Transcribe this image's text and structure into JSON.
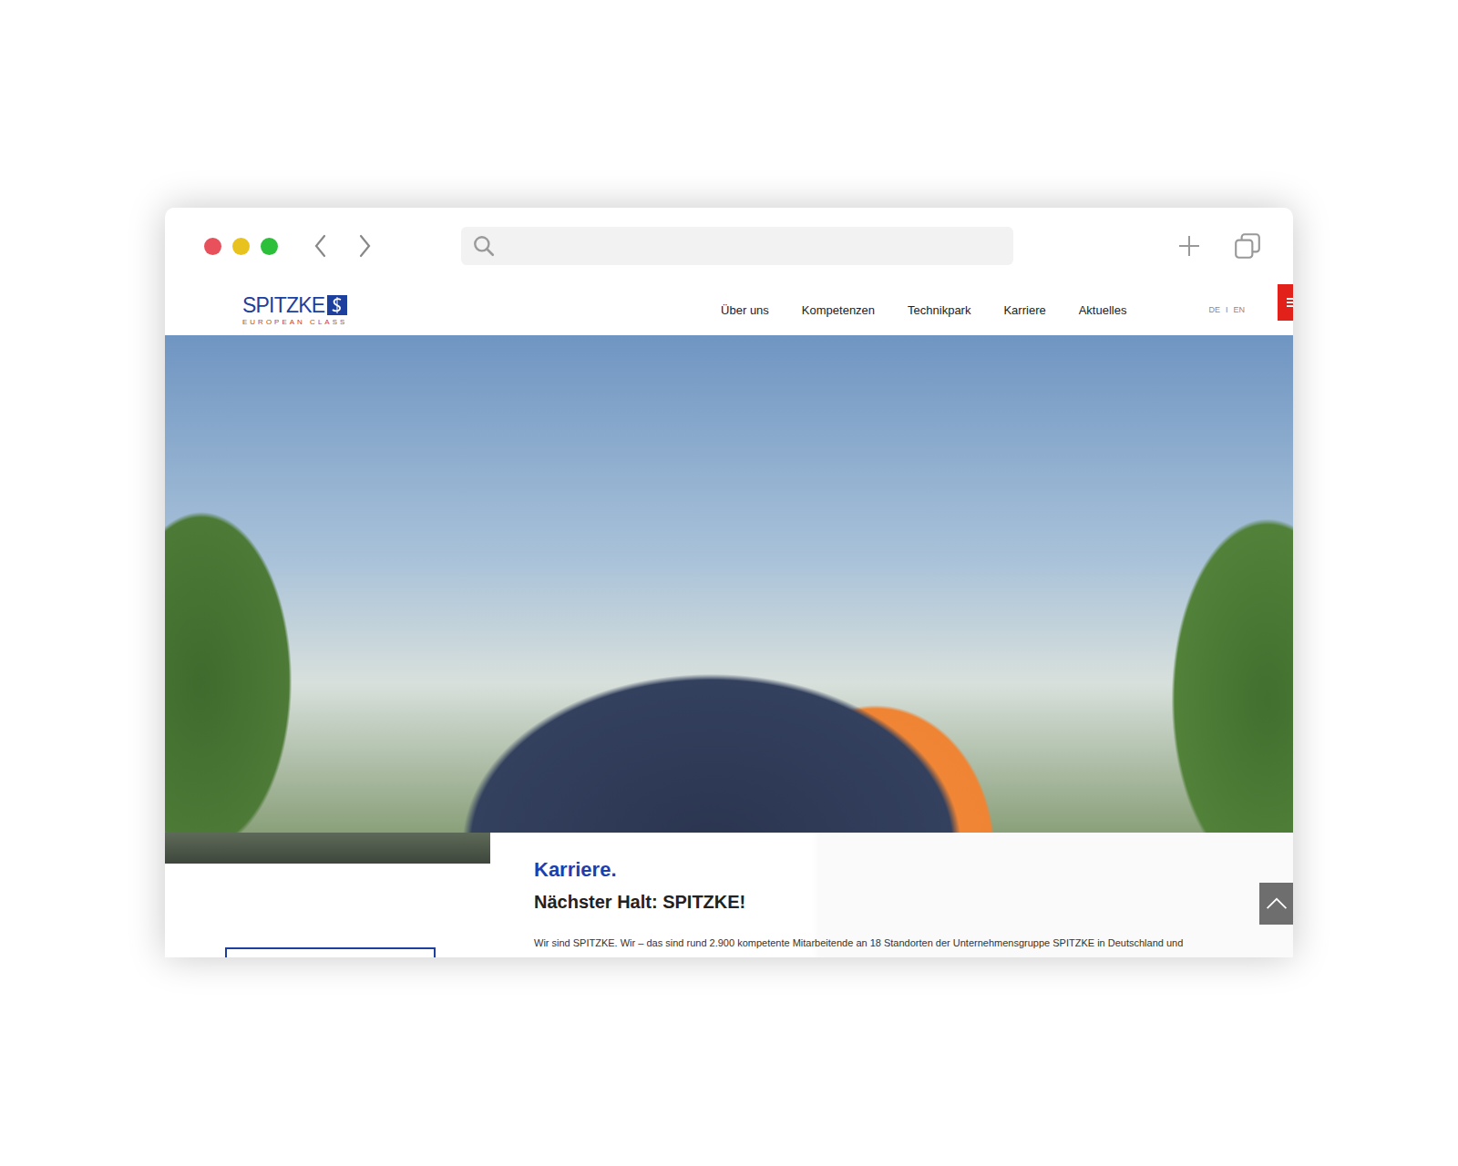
{
  "browser": {
    "search": {
      "text": ""
    }
  },
  "site": {
    "logo": {
      "name": "SPITZKE",
      "tagline": "EUROPEAN CLASS"
    },
    "nav": [
      {
        "label": "Über uns",
        "selected": false
      },
      {
        "label": "Kompetenzen",
        "selected": false
      },
      {
        "label": "Technikpark",
        "selected": false
      },
      {
        "label": "Karriere",
        "selected": false
      },
      {
        "label": "Aktuelles",
        "selected": false
      }
    ],
    "languages": [
      {
        "label": "DE",
        "selected": false
      },
      {
        "label": "EN",
        "selected": false
      }
    ],
    "language_separator": "I"
  },
  "content": {
    "section": "Karriere.",
    "heading": "Nächster Halt: SPITZKE!",
    "paragraph": "Wir sind SPITZKE. Wir – das sind rund 2.900 kompetente Mitarbeitende an 18 Standorten der Unternehmensgruppe SPITZKE in Deutschland und"
  }
}
